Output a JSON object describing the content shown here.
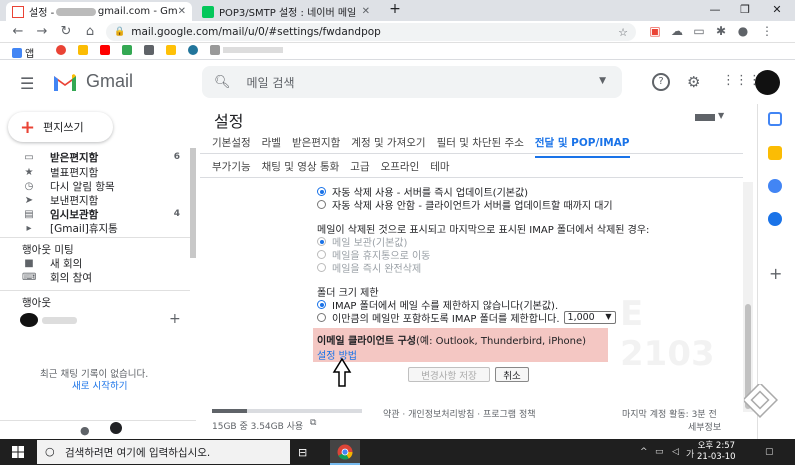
{
  "browser": {
    "tabs": [
      {
        "title": "설정 - ",
        "title_suffix": "gmail.com - Gm",
        "active": true
      },
      {
        "title": "POP3/SMTP 설정 : 네이버 메일",
        "active": false
      }
    ],
    "new_tab": "+",
    "url": "mail.google.com/mail/u/0/#settings/fwdandpop",
    "bookmarks": [
      "앱"
    ],
    "colors": {
      "tab_strip": "#dee1e6",
      "accent": "#1a73e8"
    }
  },
  "gmail": {
    "product_name": "Gmail",
    "search_placeholder": "메일 검색",
    "compose_label": "편지쓰기",
    "nav": [
      {
        "label": "받은편지함",
        "count": "6",
        "icon": "inbox-icon",
        "bold": true
      },
      {
        "label": "별표편지함",
        "count": "",
        "icon": "star-icon",
        "bold": false
      },
      {
        "label": "다시 알림 항목",
        "count": "",
        "icon": "clock-icon",
        "bold": false
      },
      {
        "label": "보낸편지함",
        "count": "",
        "icon": "send-icon",
        "bold": false
      },
      {
        "label": "임시보관함",
        "count": "4",
        "icon": "draft-icon",
        "bold": true
      },
      {
        "label": "[Gmail]휴지통",
        "count": "",
        "icon": "label-icon",
        "bold": false
      }
    ],
    "meet": {
      "heading": "행아웃 미팅",
      "new_meeting": "새 회의",
      "join_meeting": "회의 참여"
    },
    "hangouts": {
      "heading": "행아웃",
      "add": "+",
      "empty_text": "최근 채팅 기록이 없습니다.",
      "start_link": "새로 시작하기"
    },
    "settings": {
      "title": "설정",
      "tabs_row1": [
        "기본설정",
        "라벨",
        "받은편지함",
        "계정 및 가져오기",
        "필터 및 차단된 주소",
        "전달 및 POP/IMAP"
      ],
      "active_tab": "전달 및 POP/IMAP",
      "tabs_row2": [
        "부가기능",
        "채팅 및 영상 통화",
        "고급",
        "오프라인",
        "테마"
      ],
      "expunge_options": [
        {
          "label": "자동 삭제 사용 - 서버를 즉시 업데이트(기본값)",
          "checked": true,
          "disabled": false
        },
        {
          "label": "자동 삭제 사용 안함 - 클라이언트가 서버를 업데이트할 때까지 대기",
          "checked": false,
          "disabled": false
        }
      ],
      "deleted_question": "메일이 삭제된 것으로 표시되고 마지막으로 표시된 IMAP 폴더에서 삭제된 경우:",
      "deleted_options": [
        {
          "label": "메일 보관(기본값)",
          "checked": true,
          "disabled": true
        },
        {
          "label": "메일을 휴지통으로 이동",
          "checked": false,
          "disabled": true
        },
        {
          "label": "메일을 즉시 완전삭제",
          "checked": false,
          "disabled": true
        }
      ],
      "folder_size_heading": "폴더 크기 제한",
      "folder_size_options": [
        {
          "label": "IMAP 폴더에서 메일 수를 제한하지 않습니다(기본값).",
          "checked": true
        },
        {
          "label": "이만큼의 메일만 포함하도록 IMAP 폴더를 제한합니다.",
          "checked": false
        }
      ],
      "folder_limit_value": "1,000",
      "client_config": {
        "title": "이메일 클라이언트 구성",
        "examples": "(예: Outlook, Thunderbird, iPhone)",
        "link": "설정 방법",
        "highlight_color": "#f4c7c3"
      },
      "save_button": "변경사항 저장",
      "cancel_button": "취소"
    },
    "footer": {
      "storage": "15GB 중 3.54GB 사용",
      "storage_fraction": 0.236,
      "policy": "약관 · 개인정보처리방침 · 프로그램 정책",
      "activity": "마지막 계정 활동: 3분 전",
      "details": "세부정보"
    }
  },
  "taskbar": {
    "search_placeholder": "검색하려면 여기에 입력하십시오.",
    "time": "오후 2:57",
    "date": "21-03-10"
  }
}
